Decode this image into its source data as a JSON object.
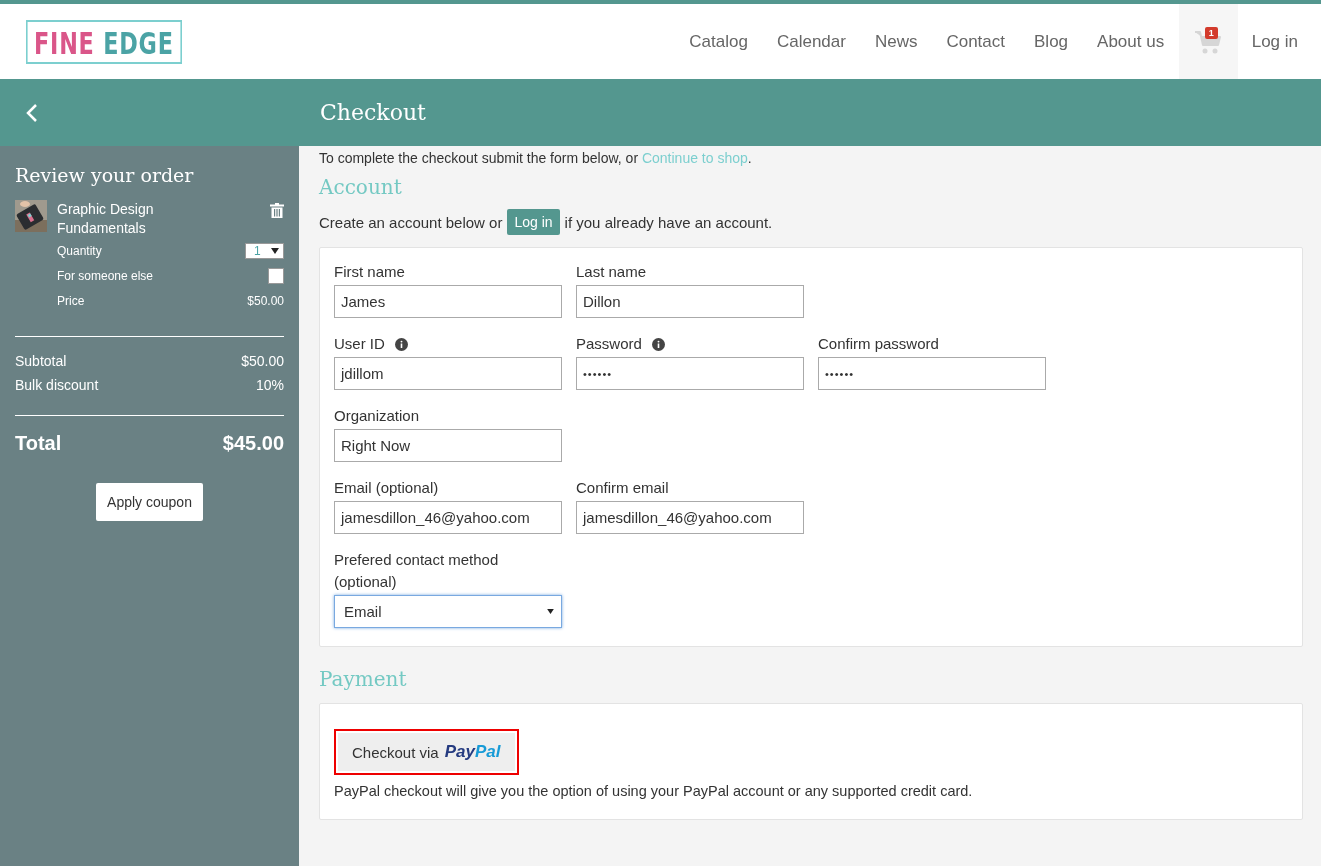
{
  "logo": {
    "word_1": "FINE",
    "word_2": "EDGE"
  },
  "nav": [
    {
      "label": "Catalog"
    },
    {
      "label": "Calendar"
    },
    {
      "label": "News"
    },
    {
      "label": "Contact"
    },
    {
      "label": "Blog"
    },
    {
      "label": "About us"
    }
  ],
  "cart": {
    "badge": "1"
  },
  "login_link": "Log in",
  "title": "Checkout",
  "sidebar": {
    "heading": "Review your order",
    "item": {
      "kind": "picture",
      "name": "Graphic Design Fundamentals",
      "quantity_label": "Quantity",
      "quantity": "1",
      "someone_label": "For someone else",
      "someone_checked": false,
      "price_label": "Price",
      "price": "$50.00"
    },
    "subtotal_label": "Subtotal",
    "subtotal": "$50.00",
    "discount_label": "Bulk discount",
    "discount": "10%",
    "total_label": "Total",
    "total": "$45.00",
    "coupon_button": "Apply coupon"
  },
  "intro": {
    "text": "To complete the checkout submit the form below, or ",
    "link": "Continue to shop",
    "end": "."
  },
  "account": {
    "heading": "Account",
    "text_before": "Create an account below or",
    "login_button": "Log in",
    "text_after": "if you already have an account.",
    "rows": [
      [
        {
          "kind": "text",
          "label": "First name",
          "value": "James",
          "info": false
        },
        {
          "kind": "text",
          "label": "Last name",
          "value": "Dillon",
          "info": false
        }
      ],
      [
        {
          "kind": "text",
          "label": "User ID",
          "value": "jdillom",
          "info": true
        },
        {
          "kind": "password",
          "label": "Password",
          "value": "••••••",
          "info": true
        },
        {
          "kind": "password",
          "label": "Confirm password",
          "value": "••••••",
          "info": false
        }
      ],
      [
        {
          "kind": "text",
          "label": "Organization",
          "value": "Right Now",
          "info": false
        }
      ],
      [
        {
          "kind": "text",
          "label": "Email (optional)",
          "value": "jamesdillon_46@yahoo.com",
          "info": false
        },
        {
          "kind": "text",
          "label": "Confirm email",
          "value": "jamesdillon_46@yahoo.com",
          "info": false
        }
      ],
      [
        {
          "kind": "select",
          "label": "Prefered contact method (optional)",
          "value": "Email",
          "info": false,
          "focused": true
        }
      ]
    ]
  },
  "payment": {
    "heading": "Payment",
    "button_text": "Checkout via",
    "logo": {
      "part_1": "Pay",
      "part_2": "Pal"
    },
    "highlighted": true,
    "note": "PayPal checkout will give you the option of using your PayPal account or any supported credit card."
  }
}
